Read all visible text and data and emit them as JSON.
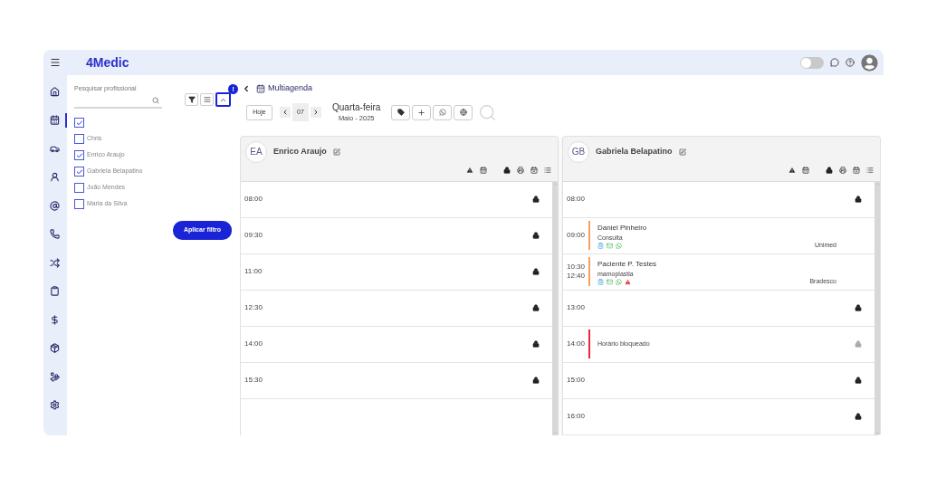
{
  "brand": "4Medic",
  "topbar": {
    "toggle_on": false
  },
  "sidebar": {
    "items": [
      {
        "kind": "home",
        "selected": false
      },
      {
        "kind": "calendar",
        "selected": true
      },
      {
        "kind": "car",
        "selected": false
      },
      {
        "kind": "user",
        "selected": false
      },
      {
        "kind": "at",
        "selected": false
      },
      {
        "kind": "phone",
        "selected": false
      },
      {
        "kind": "shuffle",
        "selected": false
      },
      {
        "kind": "clipboard",
        "selected": false
      },
      {
        "kind": "dollar",
        "selected": false
      },
      {
        "kind": "box",
        "selected": false
      },
      {
        "kind": "chart",
        "selected": false
      },
      {
        "kind": "settings",
        "selected": false
      }
    ]
  },
  "filter": {
    "search_placeholder": "Pesquisar profissional",
    "alert_badge": "!",
    "select_all_checked": true,
    "professionals": [
      {
        "name": "Chris",
        "checked": false
      },
      {
        "name": "Enrico Araujo",
        "checked": true
      },
      {
        "name": "Gabriela Belapatino",
        "checked": true
      },
      {
        "name": "João Mendes",
        "checked": false
      },
      {
        "name": "Maria da Silva",
        "checked": false
      }
    ],
    "apply_button": "Aplicar filtro"
  },
  "agenda": {
    "title": "Multiagenda",
    "today_button": "Hoje",
    "day": "07",
    "weekday": "Quarta-feira",
    "month_year": "Maio - 2025"
  },
  "columns": [
    {
      "initials": "EA",
      "name": "Enrico Araujo",
      "slots": [
        {
          "kind": "free",
          "time": "08:00"
        },
        {
          "kind": "free",
          "time": "09:30"
        },
        {
          "kind": "free",
          "time": "11:00"
        },
        {
          "kind": "free",
          "time": "12:30"
        },
        {
          "kind": "free",
          "time": "14:00"
        },
        {
          "kind": "free",
          "time": "15:30"
        }
      ]
    },
    {
      "initials": "GB",
      "name": "Gabriela Belapatino",
      "slots": [
        {
          "kind": "free",
          "time": "08:00"
        },
        {
          "kind": "appointment",
          "times": [
            "09:00"
          ],
          "patient": "Daniel Pinheiro",
          "procedure": "Consulta",
          "insurance": "Unimed",
          "warning": false
        },
        {
          "kind": "appointment",
          "times": [
            "10:30",
            "12:40"
          ],
          "patient": "Paciente P. Testes",
          "procedure": "mamoplastia",
          "insurance": "Bradesco",
          "warning": true
        },
        {
          "kind": "free",
          "time": "13:00"
        },
        {
          "kind": "blocked",
          "time": "14:00",
          "label": "Horário bloqueado"
        },
        {
          "kind": "free",
          "time": "15:00"
        },
        {
          "kind": "free",
          "time": "16:00"
        }
      ]
    }
  ]
}
